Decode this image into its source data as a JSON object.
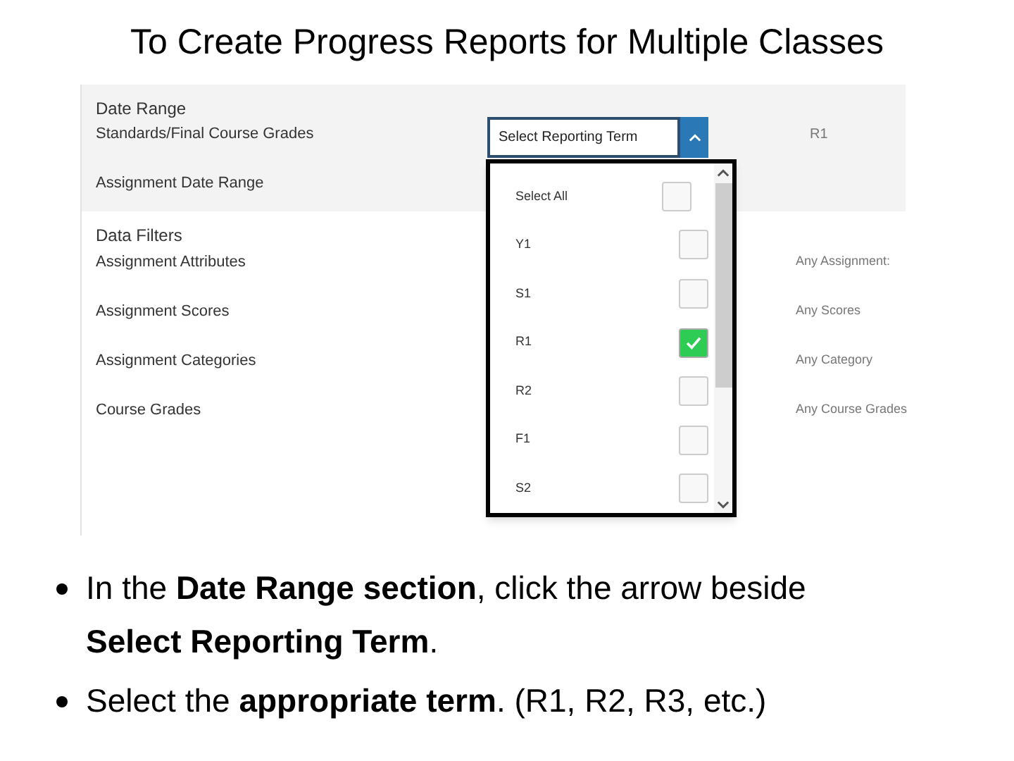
{
  "title": "To Create Progress Reports for Multiple Classes",
  "date_range": {
    "heading": "Date Range",
    "rows": [
      {
        "label": "Standards/Final Course Grades",
        "value": "R1"
      },
      {
        "label": "Assignment Date Range"
      }
    ]
  },
  "reporting_term": {
    "label": "Select Reporting Term",
    "expanded": true,
    "options": [
      {
        "label": "Select All",
        "checked": false
      },
      {
        "label": "Y1",
        "checked": false
      },
      {
        "label": "S1",
        "checked": false
      },
      {
        "label": "R1",
        "checked": true
      },
      {
        "label": "R2",
        "checked": false
      },
      {
        "label": "F1",
        "checked": false
      },
      {
        "label": "S2",
        "checked": false
      }
    ]
  },
  "data_filters": {
    "heading": "Data Filters",
    "rows": [
      {
        "label": "Assignment Attributes",
        "value": "Any Assignment:"
      },
      {
        "label": "Assignment Scores",
        "value": "Any Scores"
      },
      {
        "label": "Assignment Categories",
        "value": "Any Category"
      },
      {
        "label": "Course Grades",
        "value": "Any Course Grades"
      }
    ]
  },
  "bullets": [
    "In the **Date Range section**, click the arrow beside **Select Reporting Term**.",
    "Select the **appropriate term**. (R1, R2, R3, etc.)"
  ]
}
